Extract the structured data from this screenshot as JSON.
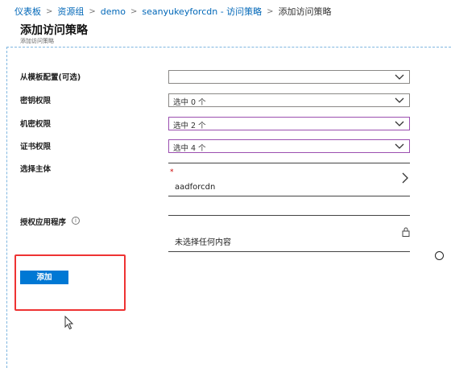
{
  "breadcrumb": {
    "items": [
      "仪表板",
      "资源组",
      "demo",
      "seanyukeyforcdn - 访问策略"
    ],
    "current": "添加访问策略",
    "separator": ">"
  },
  "page": {
    "title": "添加访问策略",
    "subtitle": "添加访问策略"
  },
  "form": {
    "template_label": "从模板配置(可选)",
    "template_value": "",
    "key_permissions_label": "密钥权限",
    "key_permissions_value": "选中 0 个",
    "secret_permissions_label": "机密权限",
    "secret_permissions_value": "选中 2 个",
    "cert_permissions_label": "证书权限",
    "cert_permissions_value": "选中 4 个",
    "principal_label": "选择主体",
    "principal_required_mark": "*",
    "principal_value": "aadforcdn",
    "authorized_app_label": "授权应用程序",
    "authorized_app_info": "i",
    "authorized_app_value": "未选择任何内容"
  },
  "actions": {
    "add_label": "添加"
  },
  "colors": {
    "accent": "#0078d4",
    "link": "#0067b8",
    "highlight_box": "#ee3333",
    "purple_border": "#9b4fb0"
  },
  "icons": {
    "chevron_down": "chevron-down-icon",
    "chevron_right": "chevron-right-icon",
    "info": "info-icon",
    "lock": "lock-icon",
    "cursor": "mouse-cursor-icon"
  }
}
